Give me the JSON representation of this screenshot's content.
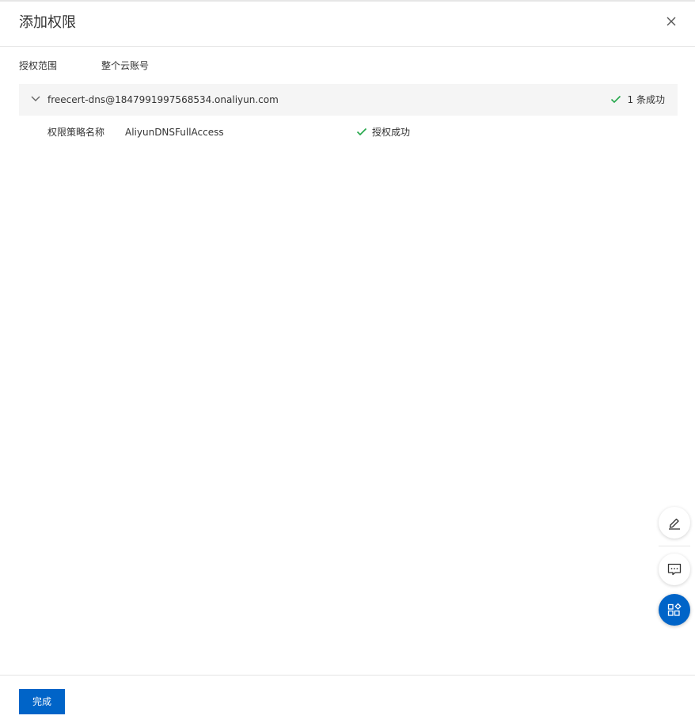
{
  "dialog": {
    "title": "添加权限",
    "close_icon": "close-icon"
  },
  "scope": {
    "label": "授权范围",
    "value": "整个云账号"
  },
  "result_group": {
    "account": "freecert-dns@1847991997568534.onaliyun.com",
    "status": "1 条成功",
    "expand_icon": "chevron-down-icon",
    "status_icon": "check-icon"
  },
  "result_rows": [
    {
      "label": "权限策略名称",
      "value": "AliyunDNSFullAccess",
      "status": "授权成功"
    }
  ],
  "floating_tools": {
    "edit_icon": "edit-pen-icon",
    "feedback_icon": "chat-bubble-icon",
    "apps_icon": "apps-grid-icon"
  },
  "footer": {
    "done_label": "完成"
  },
  "colors": {
    "primary": "#0064c8",
    "success": "#23a74a",
    "group_bg": "#f5f5f5",
    "border": "#e5e5e5"
  }
}
